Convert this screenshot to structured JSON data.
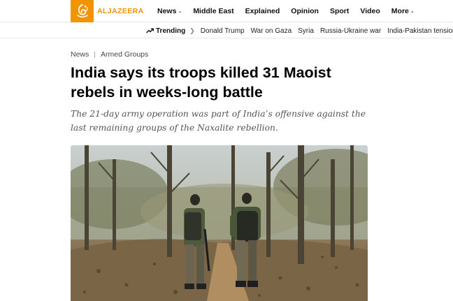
{
  "brand": {
    "name": "ALJAZEERA",
    "logo_icon": "aljazeera-calligraphy-logo",
    "accent_color": "#f29300"
  },
  "nav": {
    "items": [
      {
        "label": "News",
        "has_dropdown": true
      },
      {
        "label": "Middle East",
        "has_dropdown": false
      },
      {
        "label": "Explained",
        "has_dropdown": false
      },
      {
        "label": "Opinion",
        "has_dropdown": false
      },
      {
        "label": "Sport",
        "has_dropdown": false
      },
      {
        "label": "Video",
        "has_dropdown": false
      },
      {
        "label": "More",
        "has_dropdown": true
      }
    ],
    "dropdown_icon": "chevron-down-icon"
  },
  "trending": {
    "label": "Trending",
    "icon": "trending-arrow-icon",
    "separator_icon": "chevron-right-icon",
    "links": [
      "Donald Trump",
      "War on Gaza",
      "Syria",
      "Russia-Ukraine war",
      "India-Pakistan tensions"
    ]
  },
  "article": {
    "breadcrumbs": [
      "News",
      "Armed Groups"
    ],
    "headline": "India says its troops killed 31 Maoist rebels in weeks-long battle",
    "dek": "The 21-day army operation was part of India’s offensive against the last remaining groups of the Naxalite rebellion.",
    "hero_image": "two-soldiers-walking-forest-trail"
  }
}
